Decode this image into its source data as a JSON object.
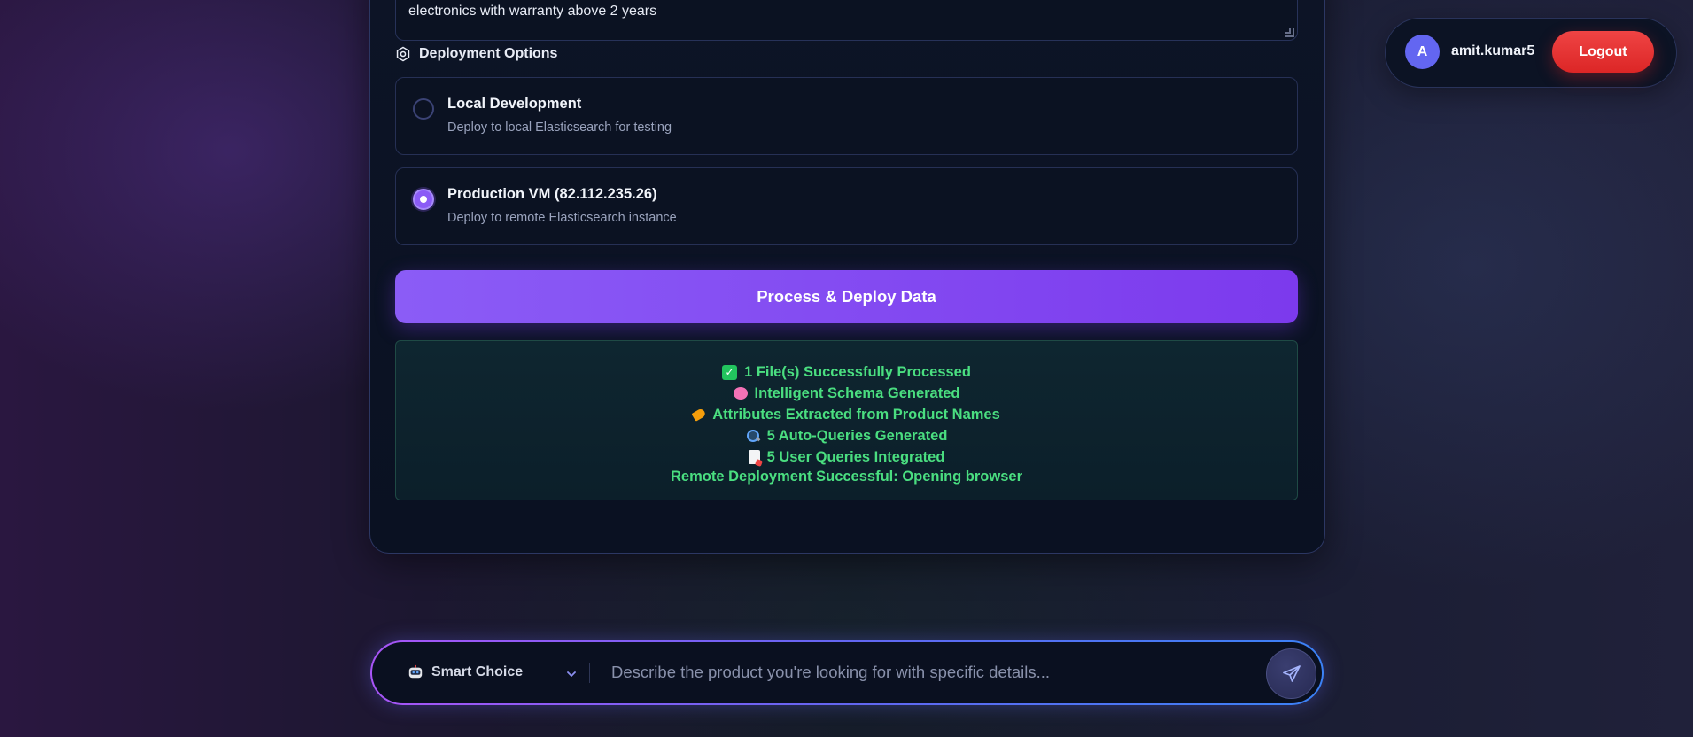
{
  "form": {
    "query_text": "electronics with warranty above 2 years"
  },
  "deployment": {
    "section_title": "Deployment Options",
    "options": [
      {
        "title": "Local Development",
        "description": "Deploy to local Elasticsearch for testing",
        "selected": false
      },
      {
        "title": "Production VM (82.112.235.26)",
        "description": "Deploy to remote Elasticsearch instance",
        "selected": true
      }
    ],
    "submit_label": "Process & Deploy Data"
  },
  "status": {
    "lines": [
      {
        "icon": "check-icon",
        "text": "1 File(s) Successfully Processed"
      },
      {
        "icon": "brain-icon",
        "text": "Intelligent Schema Generated"
      },
      {
        "icon": "tag-icon",
        "text": "Attributes Extracted from Product Names"
      },
      {
        "icon": "magnifier-icon",
        "text": "5 Auto-Queries Generated"
      },
      {
        "icon": "document-icon",
        "text": "5 User Queries Integrated"
      },
      {
        "icon": "",
        "text": "Remote Deployment Successful: Opening browser"
      }
    ],
    "color": "#4ade80"
  },
  "user": {
    "avatar_initial": "A",
    "username": "amit.kumar5",
    "logout_label": "Logout"
  },
  "chat": {
    "model_label": "Smart Choice",
    "placeholder": "Describe the product you're looking for with specific details..."
  },
  "colors": {
    "accent": "#8b5cf6",
    "danger": "#ef4444",
    "success": "#4ade80",
    "avatar": "#6366f1"
  }
}
